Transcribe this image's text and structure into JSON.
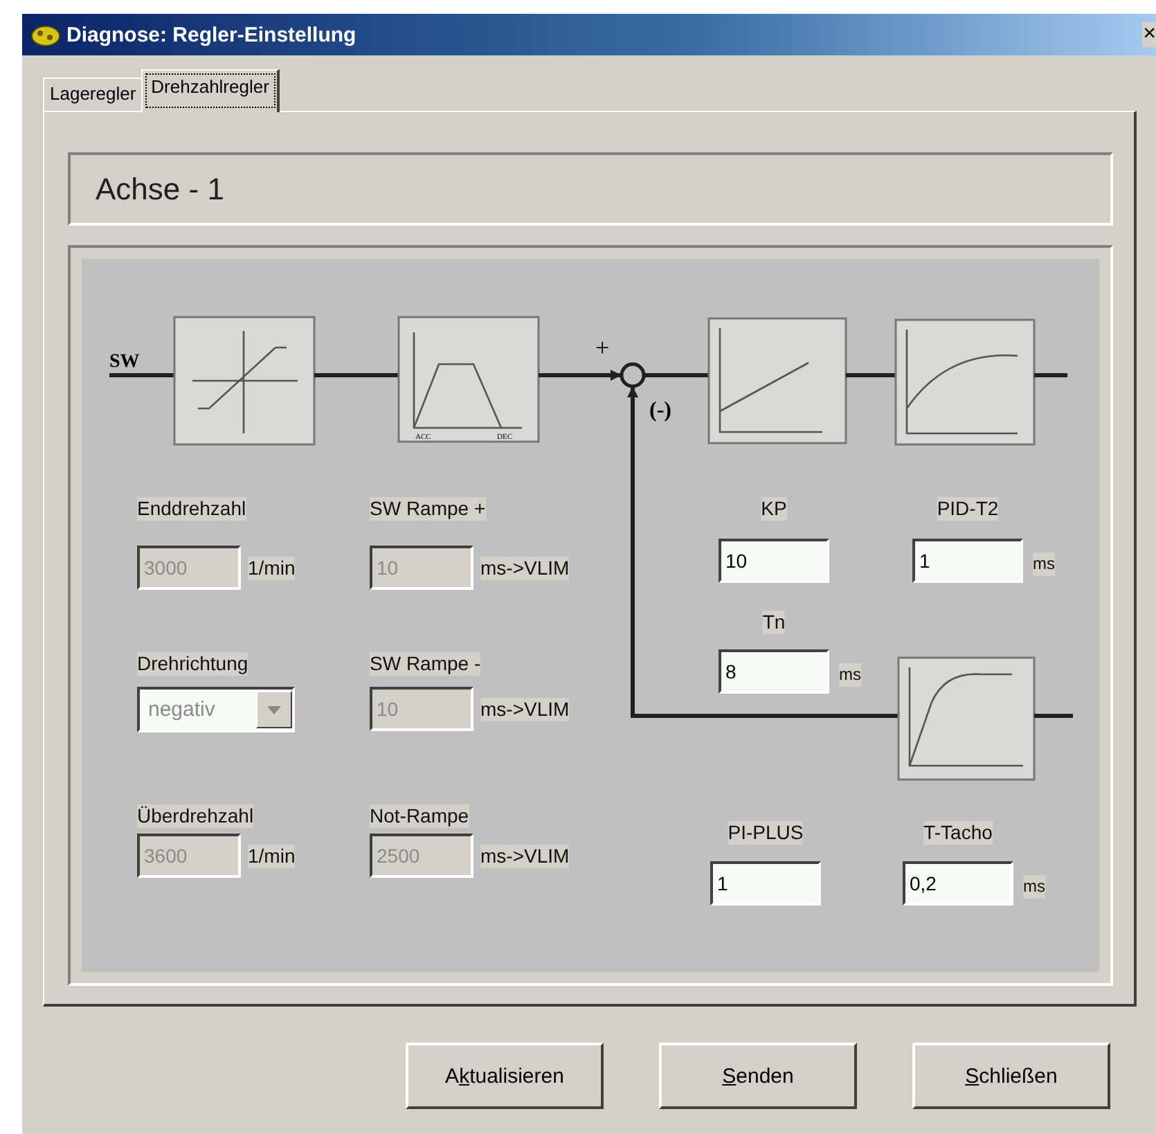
{
  "window": {
    "title": "Diagnose: Regler-Einstellung",
    "close": "×"
  },
  "tabs": [
    {
      "label": "Lageregler",
      "selected": false
    },
    {
      "label": "Drehzahlregler",
      "selected": true
    }
  ],
  "axis_title": "Achse - 1",
  "diagram": {
    "input_label": "SW",
    "plus_sign": "+",
    "minus_sign": "(-)",
    "acc_label": "ACC",
    "dec_label": "DEC"
  },
  "drive_fields": [
    {
      "label": "Enddrehzahl",
      "value": "3000",
      "unit": "1/min",
      "kind": "text",
      "disabled": true
    },
    {
      "label": "SW Rampe +",
      "value": "10",
      "unit": "ms->VLIM",
      "kind": "text",
      "disabled": true
    },
    {
      "label": "Drehrichtung",
      "value": "negativ",
      "kind": "select",
      "disabled": true
    },
    {
      "label": "SW Rampe -",
      "value": "10",
      "unit": "ms->VLIM",
      "kind": "text",
      "disabled": true
    },
    {
      "label": "Überdrehzahl",
      "value": "3600",
      "unit": "1/min",
      "kind": "text",
      "disabled": true
    },
    {
      "label": "Not-Rampe",
      "value": "2500",
      "unit": "ms->VLIM",
      "kind": "text",
      "disabled": true
    }
  ],
  "controller_fields": [
    {
      "label": "KP",
      "value": "10",
      "kind": "text",
      "disabled": false
    },
    {
      "label": "PID-T2",
      "value": "1",
      "unit": "ms",
      "kind": "text",
      "disabled": false
    },
    {
      "label": "Tn",
      "value": "8",
      "unit": "ms",
      "kind": "text",
      "disabled": false
    },
    {
      "label": "PI-PLUS",
      "value": "1",
      "kind": "text",
      "disabled": false
    },
    {
      "label": "T-Tacho",
      "value": "0,2",
      "unit": "ms",
      "kind": "text",
      "disabled": false
    }
  ],
  "buttons": [
    {
      "label_before": "A",
      "access_key": "k",
      "label_after": "tualisieren"
    },
    {
      "access_key": "S",
      "label_after": "enden"
    },
    {
      "access_key": "S",
      "label_after": "chließen"
    }
  ]
}
